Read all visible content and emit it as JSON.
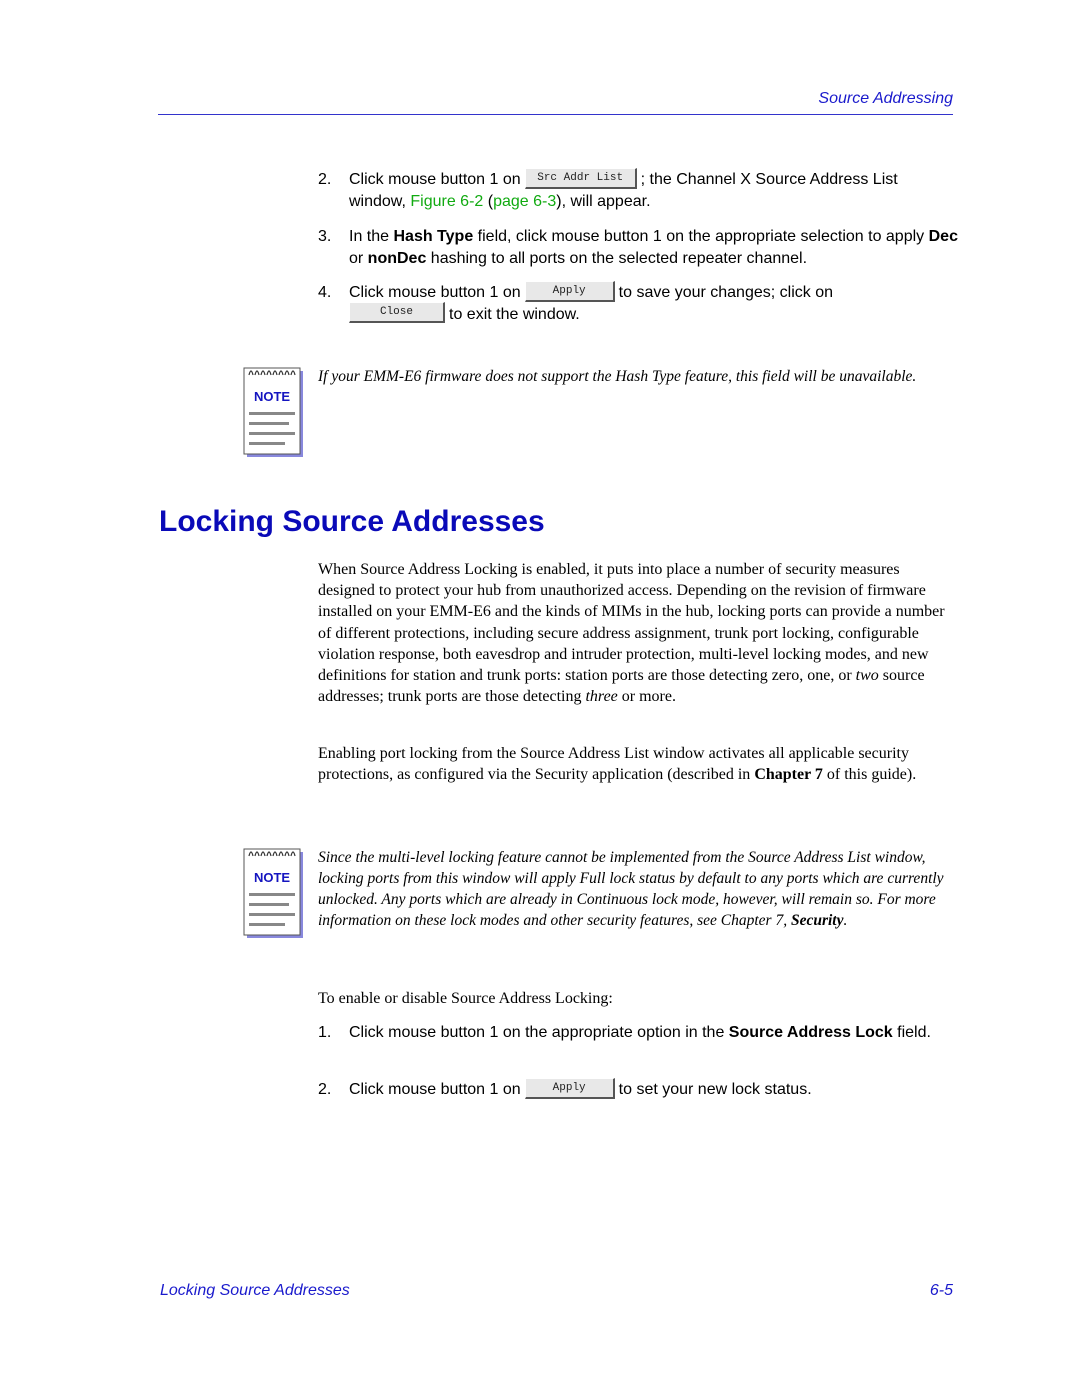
{
  "header": {
    "running_head": "Source Addressing"
  },
  "steps_top": [
    {
      "num": "2.",
      "pre": "Click mouse button 1 on",
      "button": "Src Addr List",
      "post": "; the Channel X Source Address List",
      "line2_pre": "window, ",
      "figure_link": "Figure 6-2",
      "page_link_open": " (",
      "page_link": "page 6-3",
      "line2_post": "), will appear."
    },
    {
      "num": "3.",
      "t1": "In the ",
      "b1": "Hash Type",
      "t2": " field, click mouse button 1 on the appropriate selection to apply ",
      "b2": "Dec",
      "t3": " or ",
      "b3": "nonDec",
      "t4": " hashing to all ports on the selected repeater channel."
    },
    {
      "num": "4.",
      "pre": "Click mouse button 1 on",
      "button": "Apply",
      "mid": "to save your changes; click on",
      "button2": "Close",
      "post": "to exit the window."
    }
  ],
  "note1": {
    "icon_label": "NOTE",
    "text": "If your EMM-E6 firmware does not support the Hash Type feature, this field will be unavailable."
  },
  "section": {
    "title": "Locking Source Addresses",
    "para1_a": "When Source Address Locking is enabled, it puts into place a number of security measures designed to protect your hub from unauthorized access. Depending on the revision of firmware installed on your EMM-E6 and the kinds of MIMs in the hub, locking ports can provide a number of different protections, including secure address assignment, trunk port locking, configurable violation response, both eavesdrop and intruder protection, multi-level locking modes, and new definitions for station and trunk ports: station ports are those detecting zero, one, or ",
    "para1_i1": "two",
    "para1_b": " source addresses; trunk ports are those detecting ",
    "para1_i2": "three",
    "para1_c": " or more.",
    "para2_a": "Enabling port locking from the Source Address List window activates all applicable security protections, as configured via the Security application (described in ",
    "para2_bold": "Chapter 7",
    "para2_b": " of this guide)."
  },
  "note2": {
    "icon_label": "NOTE",
    "text": "Since the multi-level locking feature cannot be implemented from the Source Address List window, locking ports from this window will apply Full lock status by default to any ports which are currently unlocked. Any ports which are already in Continuous lock mode, however, will remain so. For more information on these lock modes and other security features, see Chapter 7, ",
    "bold": "Security",
    "end": "."
  },
  "procedure": {
    "intro": "To enable or disable Source Address Locking:",
    "step1_num": "1.",
    "step1_a": "Click mouse button 1 on the appropriate option in the ",
    "step1_bold": "Source Address Lock",
    "step1_b": " field.",
    "step2_num": "2.",
    "step2_pre": "Click mouse button 1 on",
    "step2_button": "Apply",
    "step2_post": "to set your new lock status."
  },
  "footer": {
    "title": "Locking Source Addresses",
    "page": "6-5"
  }
}
